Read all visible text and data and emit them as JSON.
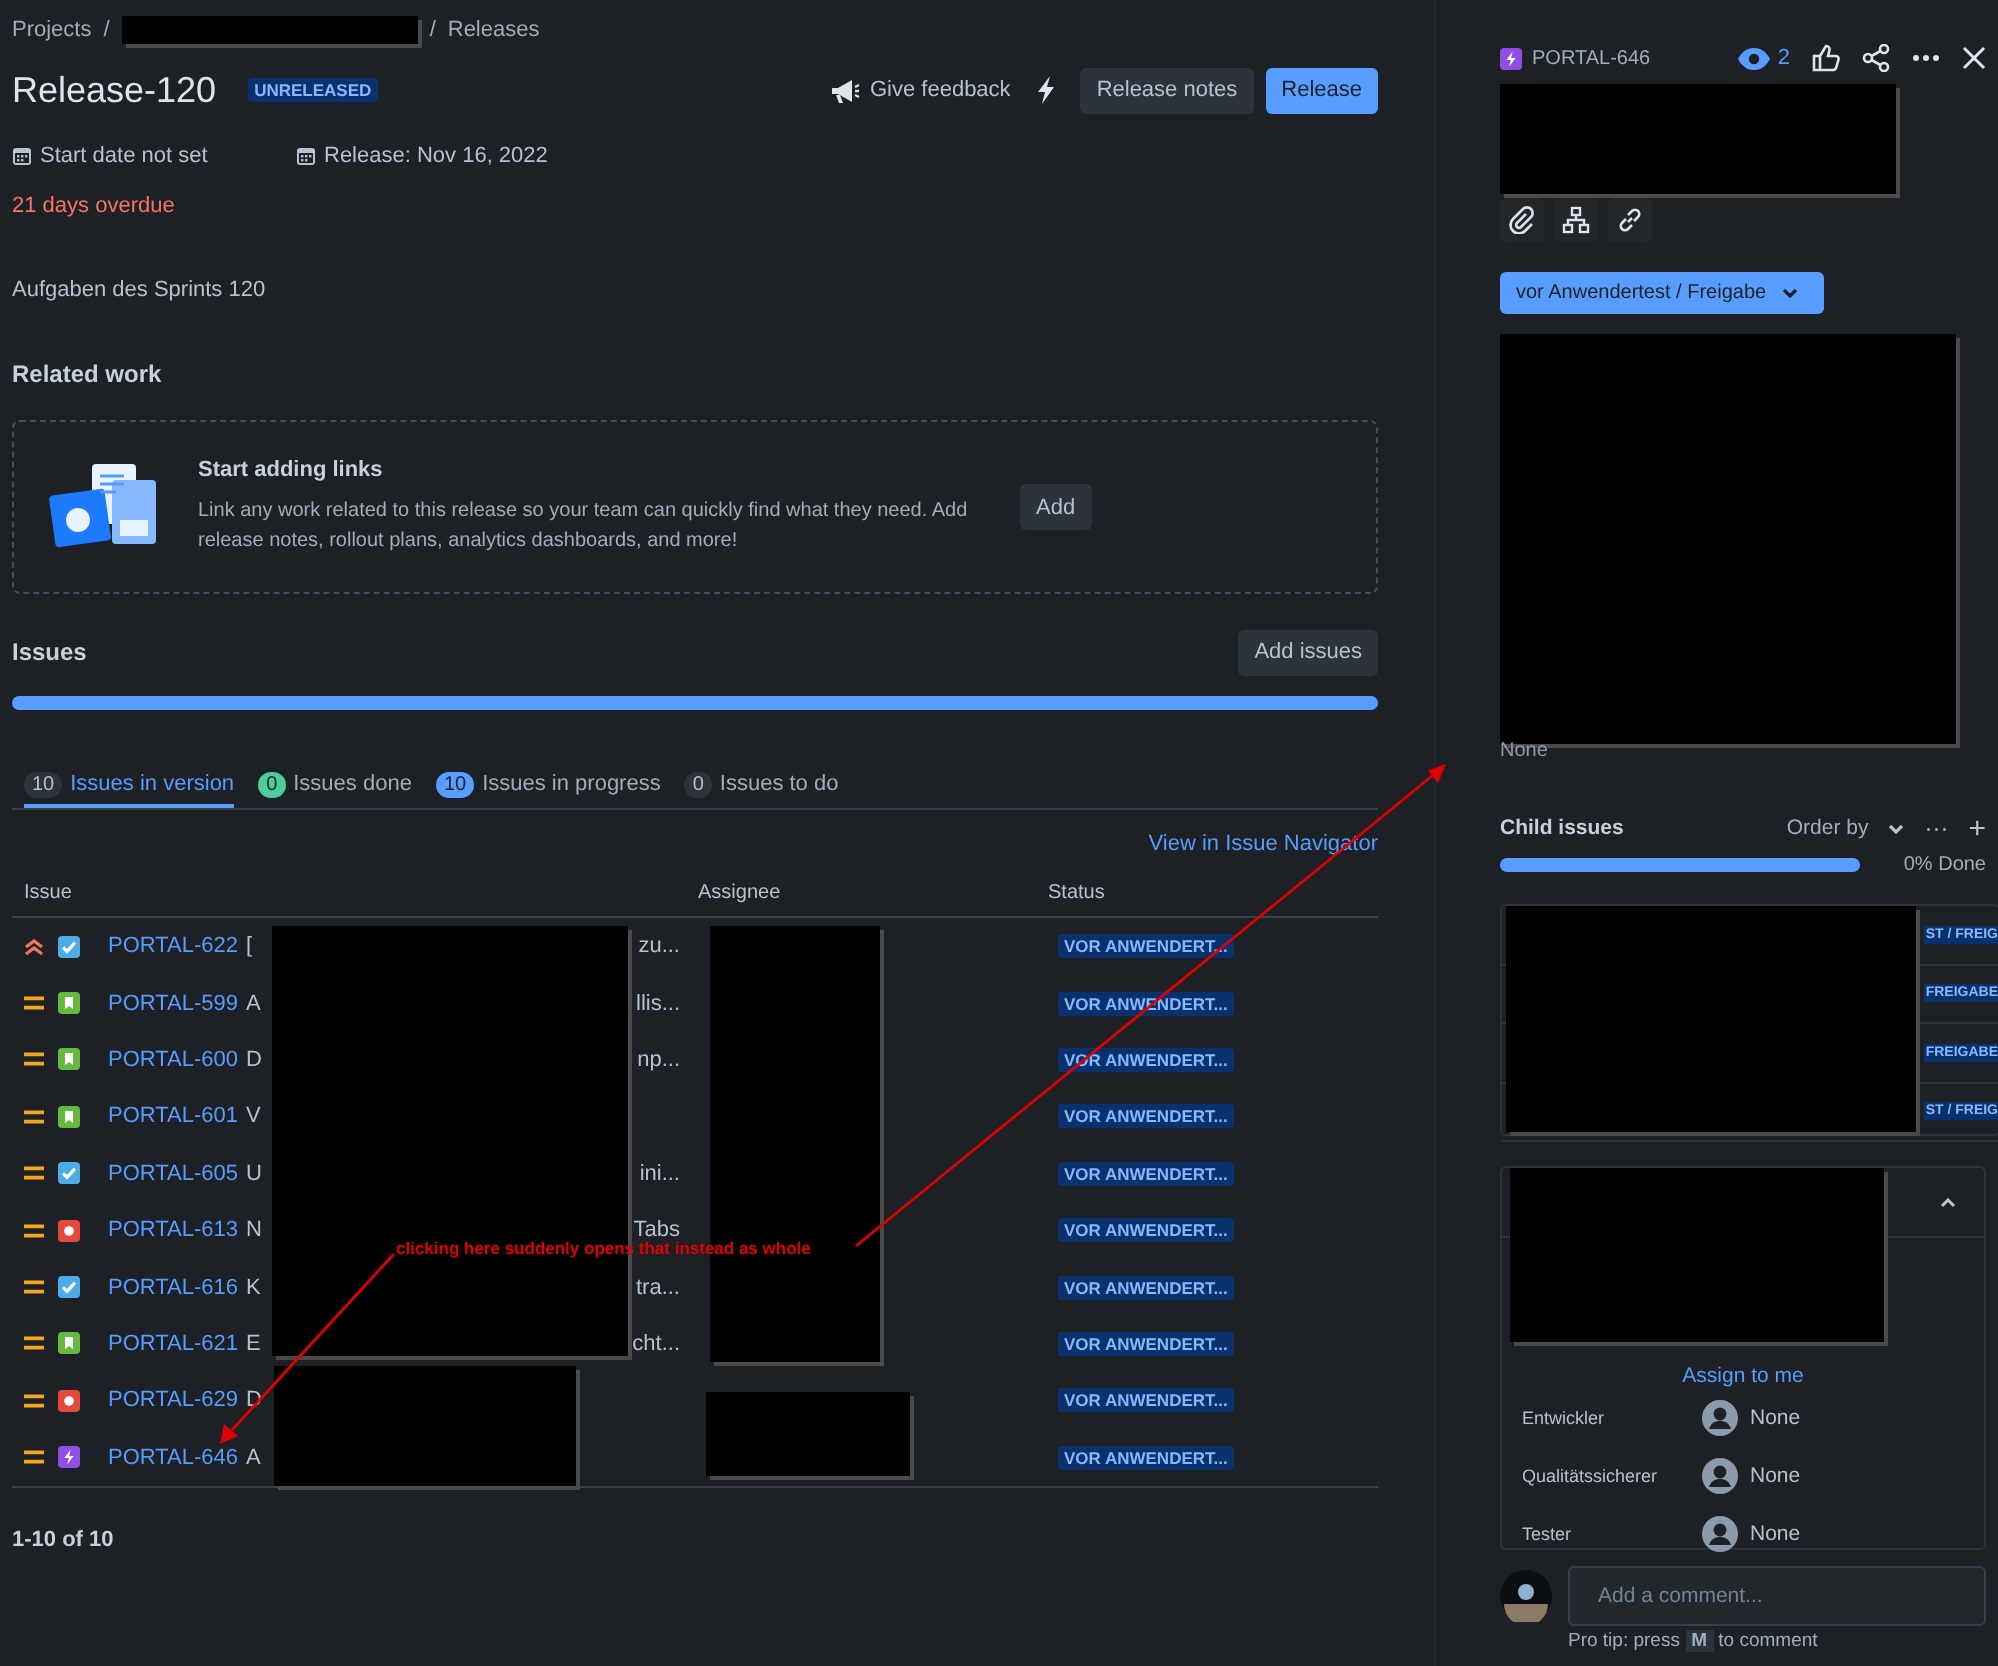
{
  "breadcrumb": {
    "root": "Projects",
    "separator": "/",
    "current": "Releases"
  },
  "release": {
    "title": "Release-120",
    "badge": "UNRELEASED",
    "start_date": "Start date not set",
    "release_date": "Release: Nov 16, 2022",
    "overdue": "21 days overdue",
    "description": "Aufgaben des Sprints 120"
  },
  "actions": {
    "feedback": "Give feedback",
    "notes": "Release notes",
    "release": "Release"
  },
  "related_work": {
    "heading": "Related work",
    "title": "Start adding links",
    "text": "Link any work related to this release so your team can quickly find what they need. Add release notes, rollout plans, analytics dashboards, and more!",
    "button": "Add"
  },
  "issues": {
    "heading": "Issues",
    "button": "Add issues",
    "level": 1,
    "tabs": [
      {
        "count": "10",
        "label": "Issues in version",
        "selected": true,
        "color": "#2c333a"
      },
      {
        "count": "0",
        "label": "Issues done",
        "selected": false,
        "color": "#4bce97"
      },
      {
        "count": "10",
        "label": "Issues in progress",
        "selected": false,
        "color": "#579dff"
      },
      {
        "count": "0",
        "label": "Issues to do",
        "selected": false,
        "color": "#2c333a"
      }
    ],
    "navigator_link": "View in Issue Navigator",
    "columns": [
      "Issue",
      "Assignee",
      "Status"
    ],
    "rows": [
      {
        "priority": {
          "kind": "high"
        },
        "type_icon": {
          "kind": "task"
        },
        "key": "PORTAL-622",
        "summary_start": "[",
        "summary_end": "zu...",
        "status": "VOR ANWENDERT..."
      },
      {
        "priority": {
          "kind": "medium"
        },
        "type_icon": {
          "kind": "story"
        },
        "key": "PORTAL-599",
        "summary_start": "A",
        "summary_end": "llis...",
        "status": "VOR ANWENDERT..."
      },
      {
        "priority": {
          "kind": "medium"
        },
        "type_icon": {
          "kind": "story"
        },
        "key": "PORTAL-600",
        "summary_start": "D",
        "summary_end": "np...",
        "status": "VOR ANWENDERT..."
      },
      {
        "priority": {
          "kind": "medium"
        },
        "type_icon": {
          "kind": "story"
        },
        "key": "PORTAL-601",
        "summary_start": "V",
        "status": "VOR ANWENDERT..."
      },
      {
        "priority": {
          "kind": "medium"
        },
        "type_icon": {
          "kind": "task"
        },
        "key": "PORTAL-605",
        "summary_start": "U",
        "summary_end": "ini...",
        "status": "VOR ANWENDERT..."
      },
      {
        "priority": {
          "kind": "medium"
        },
        "type_icon": {
          "kind": "bug"
        },
        "key": "PORTAL-613",
        "summary_start": "N",
        "summary_end": "Tabs",
        "status": "VOR ANWENDERT..."
      },
      {
        "priority": {
          "kind": "medium"
        },
        "type_icon": {
          "kind": "task"
        },
        "key": "PORTAL-616",
        "summary_start": "K",
        "summary_end": "tra...",
        "status": "VOR ANWENDERT..."
      },
      {
        "priority": {
          "kind": "medium"
        },
        "type_icon": {
          "kind": "story"
        },
        "key": "PORTAL-621",
        "summary_start": "E",
        "summary_end": "cht...",
        "status": "VOR ANWENDERT..."
      },
      {
        "priority": {
          "kind": "medium"
        },
        "type_icon": {
          "kind": "bug"
        },
        "key": "PORTAL-629",
        "summary_start": "D",
        "status": "VOR ANWENDERT..."
      },
      {
        "priority": {
          "kind": "medium"
        },
        "type_icon": {
          "kind": "epic"
        },
        "key": "PORTAL-646",
        "summary_start": "A",
        "status": "VOR ANWENDERT..."
      }
    ],
    "count": "1-10 of 10"
  },
  "annotation": {
    "text": "clicking here suddenly opens that instead as whole"
  },
  "detail": {
    "type_icon": {
      "kind": "epic"
    },
    "key": "PORTAL-646",
    "watchers": "2",
    "status_button": "vor Anwendertest / Freigabe",
    "none_text": "None",
    "child_issues": {
      "heading": "Child issues",
      "order_by": "Order by",
      "more": "···",
      "add": "+",
      "level": 1,
      "progress": "0% Done",
      "statuses": [
        "ST / FREIG",
        "FREIGABE",
        "FREIGABE",
        "ST / FREIG"
      ]
    },
    "assign_link": "Assign to me",
    "people": [
      {
        "label": "Entwickler",
        "value": "None"
      },
      {
        "label": "Qualitätssicherer",
        "value": "None"
      },
      {
        "label": "Tester",
        "value": "None"
      }
    ],
    "comment_placeholder": "Add a comment...",
    "tip": {
      "before": "Pro tip: press",
      "key": "M",
      "after": "to comment"
    }
  }
}
